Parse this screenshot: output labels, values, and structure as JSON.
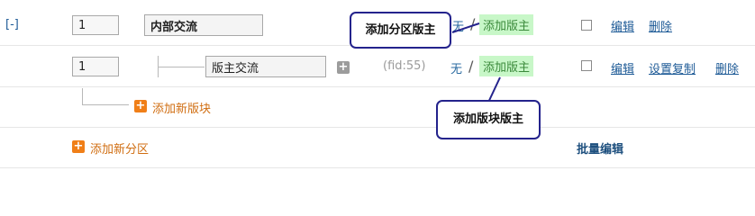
{
  "row1": {
    "toggle": "[-]",
    "order": "1",
    "name": "内部交流",
    "moderator_none": "无",
    "moderator_add": "添加版主",
    "actions": [
      "编辑",
      "删除"
    ]
  },
  "row2": {
    "order": "1",
    "name": "版主交流",
    "fid": "(fid:55)",
    "moderator_none": "无",
    "moderator_add": "添加版主",
    "actions": [
      "编辑",
      "设置复制",
      "删除"
    ]
  },
  "add_board": "添加新版块",
  "add_section": "添加新分区",
  "batch_edit": "批量编辑",
  "callouts": {
    "section_moderator": "添加分区版主",
    "board_moderator": "添加版块版主"
  }
}
